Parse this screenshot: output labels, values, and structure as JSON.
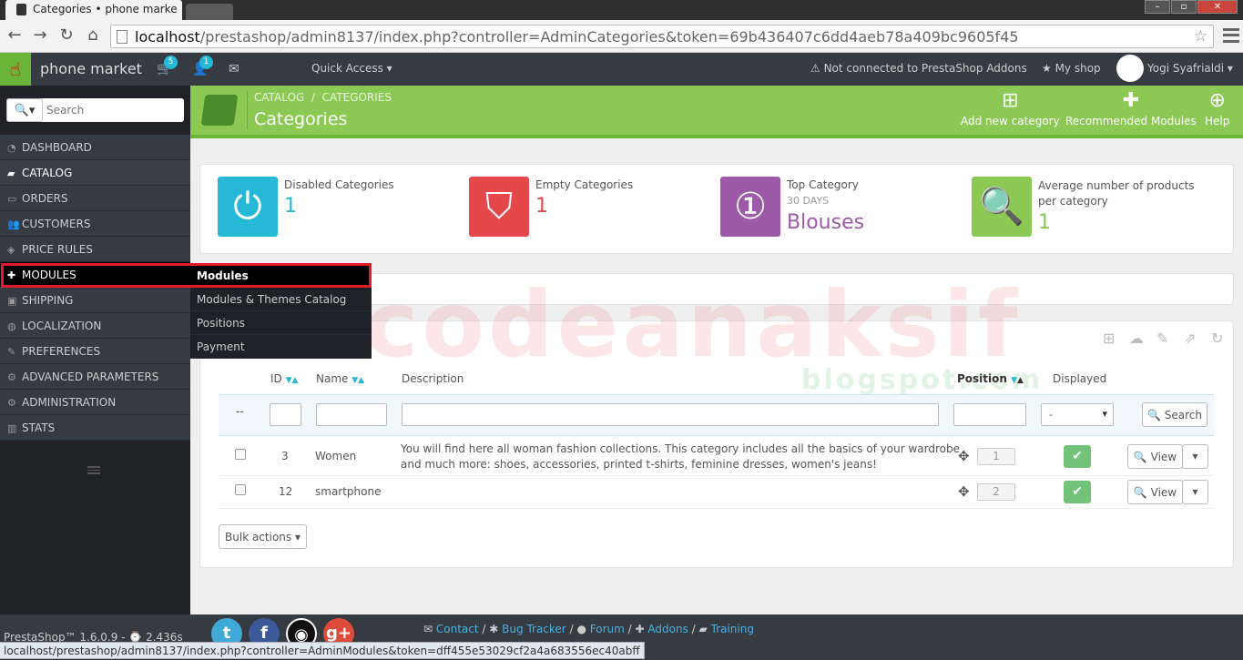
{
  "browser": {
    "tab_title": "Categories • phone marke",
    "url_host": "localhost",
    "url_path": "/prestashop/admin8137/index.php?controller=AdminCategories&token=69b436407c6dd4aeb78a409bc9605f45"
  },
  "header": {
    "shop_name": "phone market",
    "cart_count": "5",
    "customers_count": "1",
    "quick_access": "Quick Access",
    "addons": "Not connected to PrestaShop Addons",
    "my_shop": "My shop",
    "user": "Yogi Syafrialdi"
  },
  "sidebar": {
    "search_placeholder": "Search",
    "items": [
      {
        "label": "DASHBOARD",
        "icon": "dashboard-icon",
        "glyph": "◔"
      },
      {
        "label": "CATALOG",
        "icon": "catalog-icon",
        "glyph": "▰"
      },
      {
        "label": "ORDERS",
        "icon": "orders-icon",
        "glyph": "▭"
      },
      {
        "label": "CUSTOMERS",
        "icon": "customers-icon",
        "glyph": "👥"
      },
      {
        "label": "PRICE RULES",
        "icon": "price-rules-icon",
        "glyph": "◈"
      },
      {
        "label": "MODULES",
        "icon": "modules-icon",
        "glyph": "✚"
      },
      {
        "label": "SHIPPING",
        "icon": "shipping-icon",
        "glyph": "▣"
      },
      {
        "label": "LOCALIZATION",
        "icon": "localization-icon",
        "glyph": "◍"
      },
      {
        "label": "PREFERENCES",
        "icon": "preferences-icon",
        "glyph": "✎"
      },
      {
        "label": "ADVANCED PARAMETERS",
        "icon": "advanced-parameters-icon",
        "glyph": "⚙"
      },
      {
        "label": "ADMINISTRATION",
        "icon": "administration-icon",
        "glyph": "⚙"
      },
      {
        "label": "STATS",
        "icon": "stats-icon",
        "glyph": "▥"
      }
    ],
    "submenu": [
      "Modules",
      "Modules & Themes Catalog",
      "Positions",
      "Payment"
    ]
  },
  "toolbar": {
    "breadcrumb_1": "CATALOG",
    "breadcrumb_sep": "/",
    "breadcrumb_2": "CATEGORIES",
    "title": "Categories",
    "add_new": "Add new category",
    "recommended": "Recommended Modules",
    "help": "Help"
  },
  "kpis": [
    {
      "label": "Disabled Categories",
      "value": "1",
      "color": "#25b9d7"
    },
    {
      "label": "Empty Categories",
      "value": "1",
      "color": "#e5474b"
    },
    {
      "label": "Top Category",
      "sub": "30 DAYS",
      "value": "Blouses",
      "color": "#9d5aa8"
    },
    {
      "label": "Average number of products per category",
      "value": "1",
      "color": "#8bc954"
    }
  ],
  "watermark": {
    "main": "codeanaksif",
    "sub": "blogspot.com"
  },
  "table": {
    "headers": {
      "id": "ID",
      "name": "Name",
      "description": "Description",
      "position": "Position",
      "displayed": "Displayed"
    },
    "filter_dash": "--",
    "filter_select": "-",
    "search_button": "Search",
    "rows": [
      {
        "id": "3",
        "name": "Women",
        "description_1": "You will find here all woman fashion collections. This category includes all the basics of your wardrobe",
        "description_2": "and much more: shoes, accessories, printed t-shirts, feminine dresses, women's jeans!",
        "position": "1",
        "view": "View"
      },
      {
        "id": "12",
        "name": "smartphone",
        "description_1": "",
        "description_2": "",
        "position": "2",
        "view": "View"
      }
    ],
    "bulk_actions": "Bulk actions"
  },
  "footer": {
    "version": "PrestaShop™ 1.6.0.9 - ⌚ 2.436s",
    "links": [
      "Contact",
      "Bug Tracker",
      "Forum",
      "Addons",
      "Training"
    ],
    "sep": "/"
  },
  "status_url": "localhost/prestashop/admin8137/index.php?controller=AdminModules&token=dff455e53029cf2a4a683556ec40abff"
}
